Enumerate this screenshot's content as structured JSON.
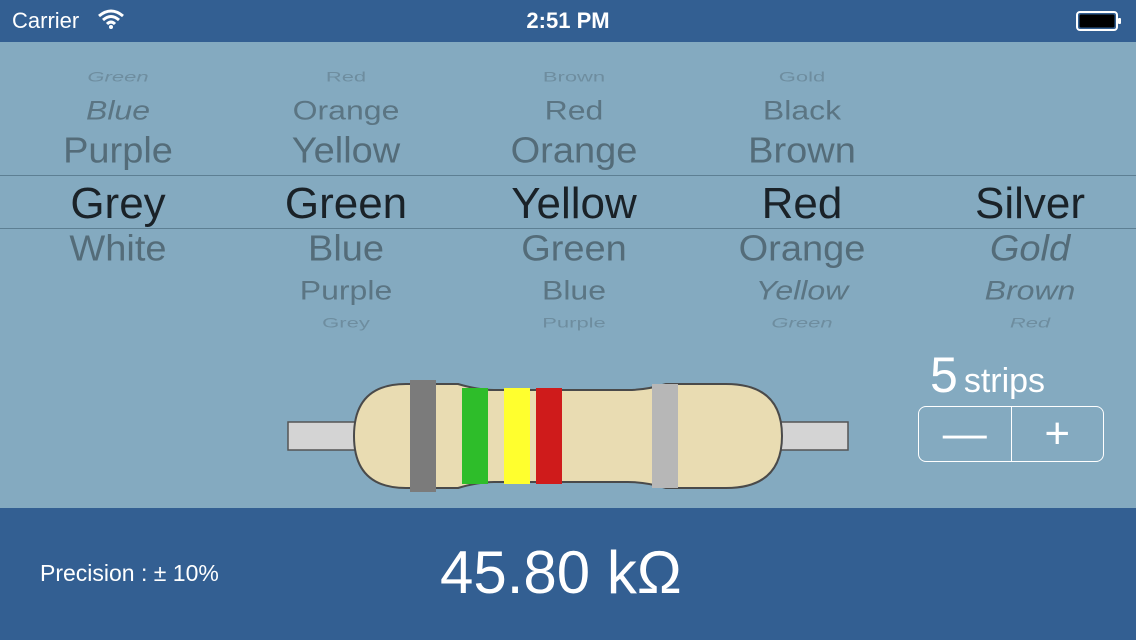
{
  "status_bar": {
    "carrier": "Carrier",
    "time": "2:51 PM"
  },
  "picker": {
    "columns": [
      {
        "above": [
          "Green",
          "Blue",
          "Purple"
        ],
        "selected": "Grey",
        "below": [
          "White",
          "",
          ""
        ]
      },
      {
        "above": [
          "Red",
          "Orange",
          "Yellow"
        ],
        "selected": "Green",
        "below": [
          "Blue",
          "Purple",
          "Grey"
        ]
      },
      {
        "above": [
          "Brown",
          "Red",
          "Orange"
        ],
        "selected": "Yellow",
        "below": [
          "Green",
          "Blue",
          "Purple"
        ]
      },
      {
        "above": [
          "Gold",
          "Black",
          "Brown"
        ],
        "selected": "Red",
        "below": [
          "Orange",
          "Yellow",
          "Green"
        ]
      },
      {
        "above": [
          "",
          "",
          ""
        ],
        "selected": "Silver",
        "below": [
          "Gold",
          "Brown",
          "Red"
        ]
      }
    ]
  },
  "resistor": {
    "body_color": "#e9dcb2",
    "lead_color": "#d4d4d4",
    "bands": [
      "#7b7b7b",
      "#2ebd2a",
      "#ffff2e",
      "#cf1b1b",
      "#b7b7b7"
    ]
  },
  "strips": {
    "count": "5",
    "label": "strips",
    "minus": "—",
    "plus": "+"
  },
  "result": {
    "precision": "Precision : ± 10%",
    "value": "45.80 kΩ"
  },
  "colors": {
    "bar": "#335f92",
    "picker_bg": "#84aac0"
  }
}
